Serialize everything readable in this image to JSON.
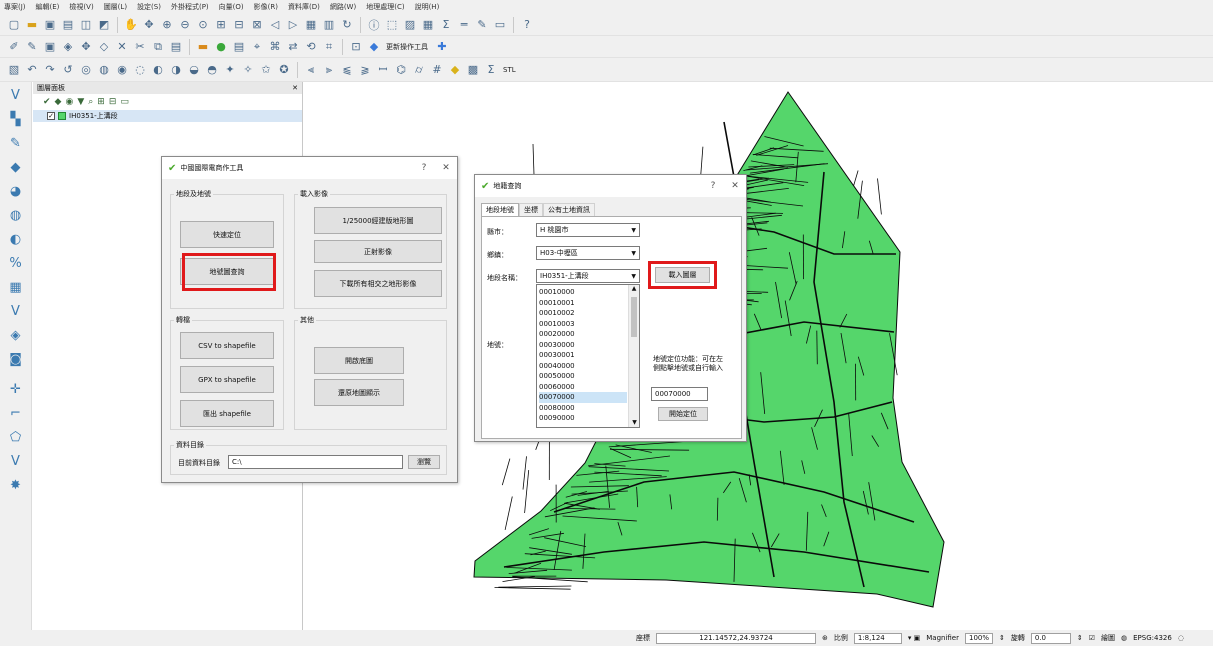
{
  "menubar": [
    "專案(J)",
    "編輯(E)",
    "檢視(V)",
    "圖層(L)",
    "設定(S)",
    "外掛程式(P)",
    "向量(O)",
    "影像(R)",
    "資料庫(D)",
    "網路(W)",
    "地理處理(C)",
    "說明(H)"
  ],
  "toolbar2_label": "更新操作工具",
  "toolbar3_label": "STL",
  "layers_panel": {
    "title": "圖層面板",
    "layer_name": "IH0351-上溝段"
  },
  "status": {
    "coordinate_label": "座標",
    "coordinate_value": "121.14572,24.93724",
    "scale_label": "比例",
    "scale_value": "1:8,124",
    "magnifier_label": "Magnifier",
    "magnifier_value": "100%",
    "rotation_label": "旋轉",
    "rotation_value": "0.0",
    "render_label": "繪圖",
    "crs": "EPSG:4326"
  },
  "tool_dialog": {
    "title": "中國國際電商作工具",
    "group_locate": "地段及地號",
    "btn_locate": "快速定位",
    "btn_query": "地號圖查詢",
    "group_image": "載入影像",
    "btn_topo": "1/25000經建版地形圖",
    "btn_ortho": "正射影像",
    "btn_download": "下載所有相交之地形影像",
    "group_convert": "轉檔",
    "btn_csv": "CSV to shapefile",
    "btn_gpx": "GPX to shapefile",
    "btn_export": "匯出 shapefile",
    "group_other": "其他",
    "btn_open_map": "開啟底圖",
    "btn_clear": "還原地圖顯示",
    "group_folder": "資料目錄",
    "folder_label": "目前資料目錄",
    "folder_value": "C:\\",
    "btn_browse": "瀏覽"
  },
  "parcel_dialog": {
    "title": "地籍查詢",
    "tabs": [
      "地段地號",
      "坐標",
      "公有土地資訊"
    ],
    "county_label": "縣市：",
    "county_value": "H 桃園市",
    "town_label": "鄉鎮：",
    "town_value": "H03-中壢區",
    "section_label": "地段名稱：",
    "section_value": "IH0351-上溝段",
    "btn_load": "載入圖層",
    "parcel_label": "地號：",
    "parcels": [
      "00010000",
      "00010001",
      "00010002",
      "00010003",
      "00020000",
      "00030000",
      "00030001",
      "00040000",
      "00050000",
      "00060000",
      "00070000",
      "00080000",
      "00090000"
    ],
    "selected_parcel": "00070000",
    "hint": "地號定位功能：可在左側點擊地號或自行輸入",
    "input_value": "00070000",
    "btn_locate": "開始定位"
  },
  "colors": {
    "parcel_fill": "#55d66b",
    "parcel_line": "#0a0a0a",
    "highlight": "#e0191a"
  }
}
